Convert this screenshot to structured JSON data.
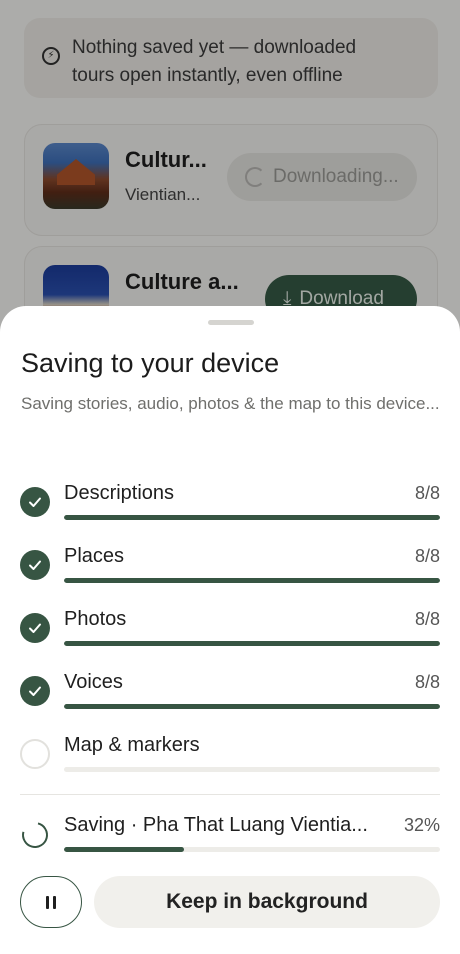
{
  "background": {
    "notice_text_line1": "Nothing saved yet — downloaded",
    "notice_text_line2": "tours open instantly, even offline",
    "tours": [
      {
        "title": "Cultur...",
        "subtitle": "Vientian...",
        "action_label": "Downloading...",
        "state": "downloading"
      },
      {
        "title": "Culture a...",
        "subtitle": "",
        "action_label": "Download",
        "state": "idle"
      }
    ]
  },
  "sheet": {
    "title": "Saving to your device",
    "subtitle": "Saving stories, audio, photos & the map to this device...",
    "steps": [
      {
        "label": "Descriptions",
        "count": "8/8",
        "done": true,
        "progress": 1.0
      },
      {
        "label": "Places",
        "count": "8/8",
        "done": true,
        "progress": 1.0
      },
      {
        "label": "Photos",
        "count": "8/8",
        "done": true,
        "progress": 1.0
      },
      {
        "label": "Voices",
        "count": "8/8",
        "done": true,
        "progress": 1.0
      },
      {
        "label": "Map & markers",
        "count": "",
        "done": false,
        "progress": 0.0
      }
    ],
    "current": {
      "label": "Saving · Pha That Luang Vientia...",
      "percent_label": "32%",
      "progress": 0.32
    },
    "keep_button_label": "Keep in background",
    "pause_icon": "pause-icon"
  },
  "colors": {
    "accent": "#375543",
    "track": "#edece8"
  }
}
